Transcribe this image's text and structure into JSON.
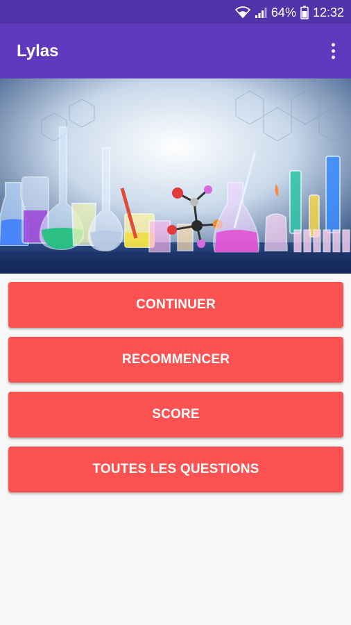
{
  "status_bar": {
    "battery": "64%",
    "time": "12:32"
  },
  "app_bar": {
    "title": "Lylas"
  },
  "hero": {
    "image": "laboratory-glassware-image"
  },
  "buttons": {
    "continue": "CONTINUER",
    "restart": "RECOMMENCER",
    "score": "SCORE",
    "all_questions": "TOUTES LES QUESTIONS"
  },
  "colors": {
    "status_bar": "#5134a9",
    "app_bar": "#6139bf",
    "button": "#fd5252",
    "background": "#f7f7f7"
  }
}
